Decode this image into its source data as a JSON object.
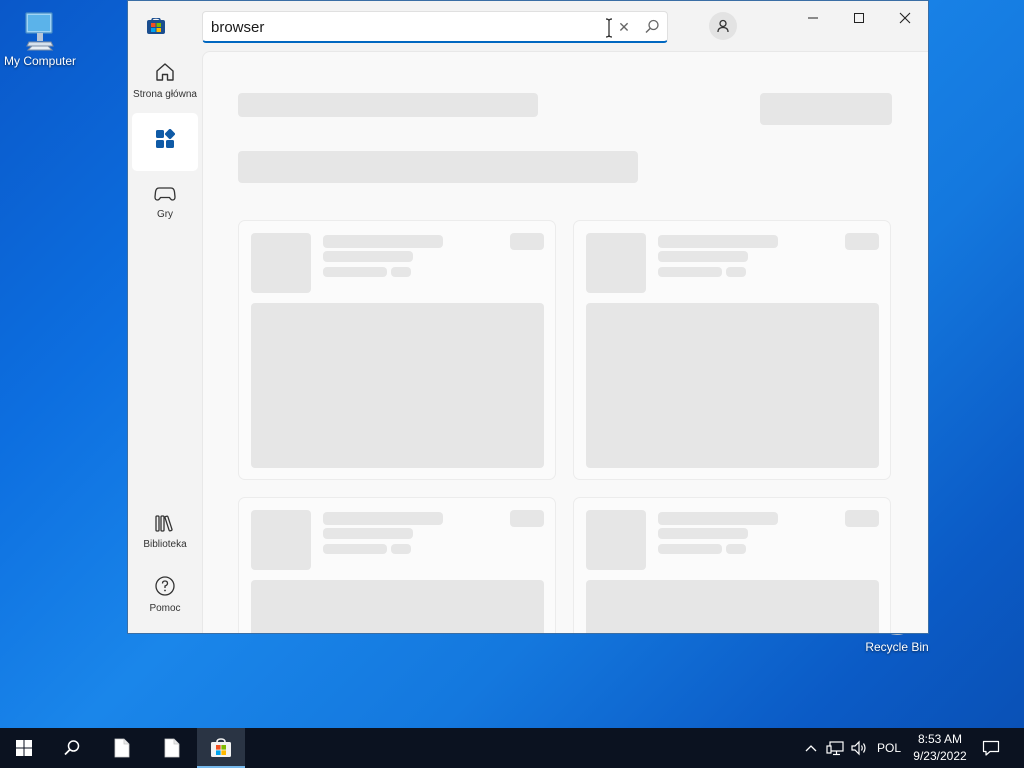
{
  "desktop": {
    "icons": [
      {
        "label": "My Computer",
        "icon": "computer-icon"
      },
      {
        "label": "Recycle Bin",
        "icon": "recycle-bin-icon"
      }
    ]
  },
  "window": {
    "app_icon": "microsoft-store-icon",
    "search": {
      "value": "browser",
      "placeholder": ""
    },
    "nav": {
      "home_label": "Strona główna",
      "apps_label": "",
      "games_label": "Gry",
      "library_label": "Biblioteka",
      "help_label": "Pomoc"
    },
    "state": "loading-placeholders"
  },
  "taskbar": {
    "items": [
      "start-icon",
      "search-icon",
      "file-icon",
      "file-icon",
      "microsoft-store-icon"
    ],
    "language": "POL",
    "time": "8:53 AM",
    "date": "9/23/2022"
  },
  "colors": {
    "accent": "#0067c0",
    "skeleton": "#e6e6e6",
    "taskbar": "#0b1220"
  }
}
